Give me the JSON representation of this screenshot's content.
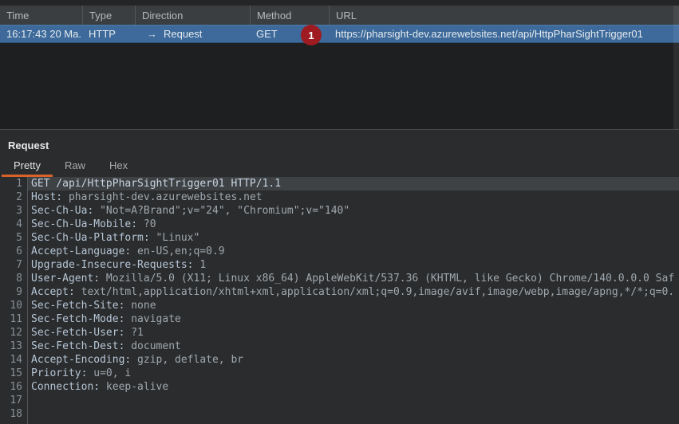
{
  "colors": {
    "selected_row_blue": "#3d6a9a",
    "badge_red": "#9e1b21",
    "accent_orange": "#d8622a",
    "panel_background": "#2b2c2d"
  },
  "table": {
    "columns": [
      {
        "key": "time",
        "label": "Time"
      },
      {
        "key": "type",
        "label": "Type"
      },
      {
        "key": "direction",
        "label": "Direction"
      },
      {
        "key": "method",
        "label": "Method"
      },
      {
        "key": "url",
        "label": "URL"
      }
    ],
    "row": {
      "time": "16:17:43 20 Ma...",
      "type": "HTTP",
      "direction_arrow": "→",
      "direction": "Request",
      "method": "GET",
      "badge": "1",
      "url": "https://pharsight-dev.azurewebsites.net/api/HttpPharSightTrigger01"
    }
  },
  "panel": {
    "title": "Request",
    "tabs": [
      {
        "label": "Pretty",
        "active": true
      },
      {
        "label": "Raw",
        "active": false
      },
      {
        "label": "Hex",
        "active": false
      }
    ],
    "lines": [
      {
        "num": "1",
        "hl": true,
        "parts": [
          {
            "c": "reqline",
            "t": "GET /api/HttpPharSightTrigger01 HTTP/1.1"
          }
        ]
      },
      {
        "num": "2",
        "parts": [
          {
            "c": "hname",
            "t": "Host:"
          },
          {
            "c": "hval",
            "t": " pharsight-dev.azurewebsites.net"
          }
        ]
      },
      {
        "num": "3",
        "parts": [
          {
            "c": "hname",
            "t": "Sec-Ch-Ua:"
          },
          {
            "c": "hval",
            "t": " \"Not=A?Brand\";v=\"24\", \"Chromium\";v=\"140\""
          }
        ]
      },
      {
        "num": "4",
        "parts": [
          {
            "c": "hname",
            "t": "Sec-Ch-Ua-Mobile:"
          },
          {
            "c": "hval",
            "t": " ?0"
          }
        ]
      },
      {
        "num": "5",
        "parts": [
          {
            "c": "hname",
            "t": "Sec-Ch-Ua-Platform:"
          },
          {
            "c": "hval",
            "t": " \"Linux\""
          }
        ]
      },
      {
        "num": "6",
        "parts": [
          {
            "c": "hname",
            "t": "Accept-Language:"
          },
          {
            "c": "hval",
            "t": " en-US,en;q=0.9"
          }
        ]
      },
      {
        "num": "7",
        "parts": [
          {
            "c": "hname",
            "t": "Upgrade-Insecure-Requests:"
          },
          {
            "c": "hval",
            "t": " 1"
          }
        ]
      },
      {
        "num": "8",
        "parts": [
          {
            "c": "hname",
            "t": "User-Agent:"
          },
          {
            "c": "hval",
            "t": " Mozilla/5.0 (X11; Linux x86_64) AppleWebKit/537.36 (KHTML, like Gecko) Chrome/140.0.0.0 Saf"
          }
        ]
      },
      {
        "num": "9",
        "parts": [
          {
            "c": "hname",
            "t": "Accept:"
          },
          {
            "c": "hval",
            "t": " text/html,application/xhtml+xml,application/xml;q=0.9,image/avif,image/webp,image/apng,*/*;q=0."
          }
        ]
      },
      {
        "num": "10",
        "parts": [
          {
            "c": "hname",
            "t": "Sec-Fetch-Site:"
          },
          {
            "c": "hval",
            "t": " none"
          }
        ]
      },
      {
        "num": "11",
        "parts": [
          {
            "c": "hname",
            "t": "Sec-Fetch-Mode:"
          },
          {
            "c": "hval",
            "t": " navigate"
          }
        ]
      },
      {
        "num": "12",
        "parts": [
          {
            "c": "hname",
            "t": "Sec-Fetch-User:"
          },
          {
            "c": "hval",
            "t": " ?1"
          }
        ]
      },
      {
        "num": "13",
        "parts": [
          {
            "c": "hname",
            "t": "Sec-Fetch-Dest:"
          },
          {
            "c": "hval",
            "t": " document"
          }
        ]
      },
      {
        "num": "14",
        "parts": [
          {
            "c": "hname",
            "t": "Accept-Encoding:"
          },
          {
            "c": "hval",
            "t": " gzip, deflate, br"
          }
        ]
      },
      {
        "num": "15",
        "parts": [
          {
            "c": "hname",
            "t": "Priority:"
          },
          {
            "c": "hval",
            "t": " u=0, i"
          }
        ]
      },
      {
        "num": "16",
        "parts": [
          {
            "c": "hname",
            "t": "Connection:"
          },
          {
            "c": "hval",
            "t": " keep-alive"
          }
        ]
      },
      {
        "num": "17",
        "parts": []
      },
      {
        "num": "18",
        "parts": []
      }
    ]
  }
}
